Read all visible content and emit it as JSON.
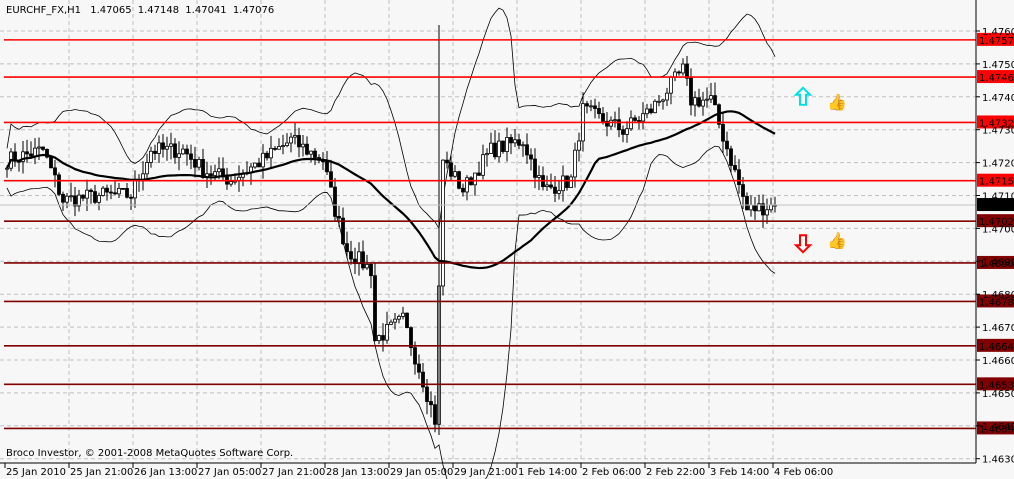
{
  "header": {
    "symbol": "EURCHF_FX,H1",
    "open": "1.47065",
    "high": "1.47148",
    "low": "1.47041",
    "close": "1.47076"
  },
  "copyright": "Broco Investor, © 2001-2008 MetaQuotes Software Corp.",
  "colors": {
    "background": "#f7f7f7",
    "grid": "#c0c0c0",
    "level_red": "#ff0000",
    "level_dark": "#800000",
    "bid": "#000000",
    "up_arrow": "#00e0e0",
    "down_arrow": "#ff0000"
  },
  "chart_data": {
    "type": "candlestick",
    "title": "EURCHF_FX,H1",
    "ylim": [
      1.46255,
      1.47655
    ],
    "y_ticks": [
      "1.47605",
      "1.47505",
      "1.47405",
      "1.47305",
      "1.47205",
      "1.47105",
      "1.47005",
      "1.46905",
      "1.46805",
      "1.46705",
      "1.46605",
      "1.46505",
      "1.46405",
      "1.46305"
    ],
    "x_ticks": [
      "25 Jan 2010",
      "25 Jan 21:00",
      "26 Jan 13:00",
      "27 Jan 05:00",
      "27 Jan 21:00",
      "28 Jan 13:00",
      "29 Jan 05:00",
      "29 Jan 21:00",
      "1 Feb 14:00",
      "2 Feb 06:00",
      "2 Feb 22:00",
      "3 Feb 14:00",
      "4 Feb 06:00"
    ],
    "bars_per_tick": 16,
    "close_path_anchors": [
      [
        0,
        1.47213
      ],
      [
        9,
        1.47243
      ],
      [
        14,
        1.47091
      ],
      [
        24,
        1.47106
      ],
      [
        31,
        1.47106
      ],
      [
        36,
        1.47243
      ],
      [
        44,
        1.47243
      ],
      [
        49,
        1.47182
      ],
      [
        56,
        1.47152
      ],
      [
        64,
        1.47213
      ],
      [
        71,
        1.47273
      ],
      [
        79,
        1.47213
      ],
      [
        82,
        1.47061
      ],
      [
        85,
        1.46939
      ],
      [
        91,
        1.46879
      ],
      [
        92,
        1.46666
      ],
      [
        99,
        1.46727
      ],
      [
        104,
        1.46544
      ],
      [
        107,
        1.46423
      ],
      [
        109,
        1.47213
      ],
      [
        114,
        1.47122
      ],
      [
        121,
        1.47243
      ],
      [
        129,
        1.47273
      ],
      [
        134,
        1.47122
      ],
      [
        141,
        1.47152
      ],
      [
        144,
        1.47365
      ],
      [
        154,
        1.47304
      ],
      [
        161,
        1.47365
      ],
      [
        169,
        1.47486
      ],
      [
        171,
        1.47395
      ],
      [
        176,
        1.47395
      ],
      [
        181,
        1.47213
      ],
      [
        185,
        1.47061
      ],
      [
        192,
        1.47076
      ]
    ],
    "levels": [
      {
        "price": "1.47578",
        "style": "red"
      },
      {
        "price": "1.47465",
        "style": "red"
      },
      {
        "price": "1.47327",
        "style": "red"
      },
      {
        "price": "1.47150",
        "style": "red"
      },
      {
        "price": "1.47027",
        "style": "dark"
      },
      {
        "price": "1.46900",
        "style": "dark"
      },
      {
        "price": "1.46783",
        "style": "dark"
      },
      {
        "price": "1.46648",
        "style": "dark"
      },
      {
        "price": "1.46531",
        "style": "dark"
      },
      {
        "price": "1.46397",
        "style": "dark"
      }
    ],
    "bid_label": "1.47076",
    "signals": [
      {
        "type": "up-arrow",
        "price": 1.47405,
        "bar": 199
      },
      {
        "type": "thumbs-up",
        "price": 1.4739,
        "bar": 207
      },
      {
        "type": "down-arrow",
        "price": 1.4696,
        "bar": 199
      },
      {
        "type": "thumbs-up",
        "price": 1.4697,
        "bar": 207
      }
    ]
  }
}
